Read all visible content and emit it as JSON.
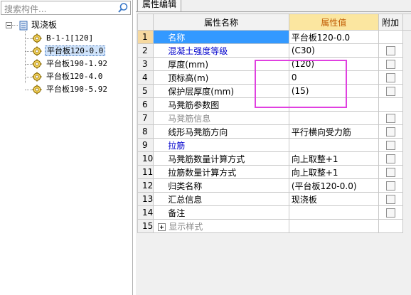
{
  "search": {
    "placeholder": "搜索构件..."
  },
  "tree": {
    "root": "现浇板",
    "children": [
      "B-1-1[120]",
      "平台板120-0.0",
      "平台板190-1.92",
      "平台板120-4.0",
      "平台板190-5.92"
    ],
    "selected_index": 1
  },
  "panel": {
    "tab_label": "属性编辑"
  },
  "grid": {
    "headers": {
      "name": "属性名称",
      "value": "属性值",
      "add": "附加"
    },
    "rows": [
      {
        "num": "1",
        "name": "名称",
        "value": "平台板120-0.0",
        "style": "selected",
        "checkbox": false
      },
      {
        "num": "2",
        "name": "混凝土强度等级",
        "value": "(C30)",
        "style": "blue",
        "checkbox": true
      },
      {
        "num": "3",
        "name": "厚度(mm)",
        "value": "(120)",
        "style": "normal",
        "checkbox": true
      },
      {
        "num": "4",
        "name": "顶标高(m)",
        "value": "0",
        "style": "normal",
        "checkbox": true
      },
      {
        "num": "5",
        "name": "保护层厚度(mm)",
        "value": "(15)",
        "style": "normal",
        "checkbox": true
      },
      {
        "num": "6",
        "name": "马凳筋参数图",
        "value": "",
        "style": "normal",
        "checkbox": false
      },
      {
        "num": "7",
        "name": "马凳筋信息",
        "value": "",
        "style": "gray",
        "checkbox": true
      },
      {
        "num": "8",
        "name": "线形马凳筋方向",
        "value": "平行横向受力筋",
        "style": "normal",
        "checkbox": true
      },
      {
        "num": "9",
        "name": "拉筋",
        "value": "",
        "style": "blue",
        "checkbox": true
      },
      {
        "num": "10",
        "name": "马凳筋数量计算方式",
        "value": "向上取整+1",
        "style": "normal",
        "checkbox": true
      },
      {
        "num": "11",
        "name": "拉筋数量计算方式",
        "value": "向上取整+1",
        "style": "normal",
        "checkbox": true
      },
      {
        "num": "12",
        "name": "归类名称",
        "value": "(平台板120-0.0)",
        "style": "normal",
        "checkbox": true
      },
      {
        "num": "13",
        "name": "汇总信息",
        "value": "现浇板",
        "style": "normal",
        "checkbox": true
      },
      {
        "num": "14",
        "name": "备注",
        "value": "",
        "style": "normal",
        "checkbox": true
      },
      {
        "num": "15",
        "name": "显示样式",
        "value": "",
        "style": "gray-expand",
        "checkbox": false
      }
    ]
  },
  "colors": {
    "annotation": "#e040e0",
    "header_value_bg": "#fbe6a0",
    "header_value_text": "#c05a00",
    "selection": "#3399ff",
    "link_blue": "#0000cc"
  }
}
